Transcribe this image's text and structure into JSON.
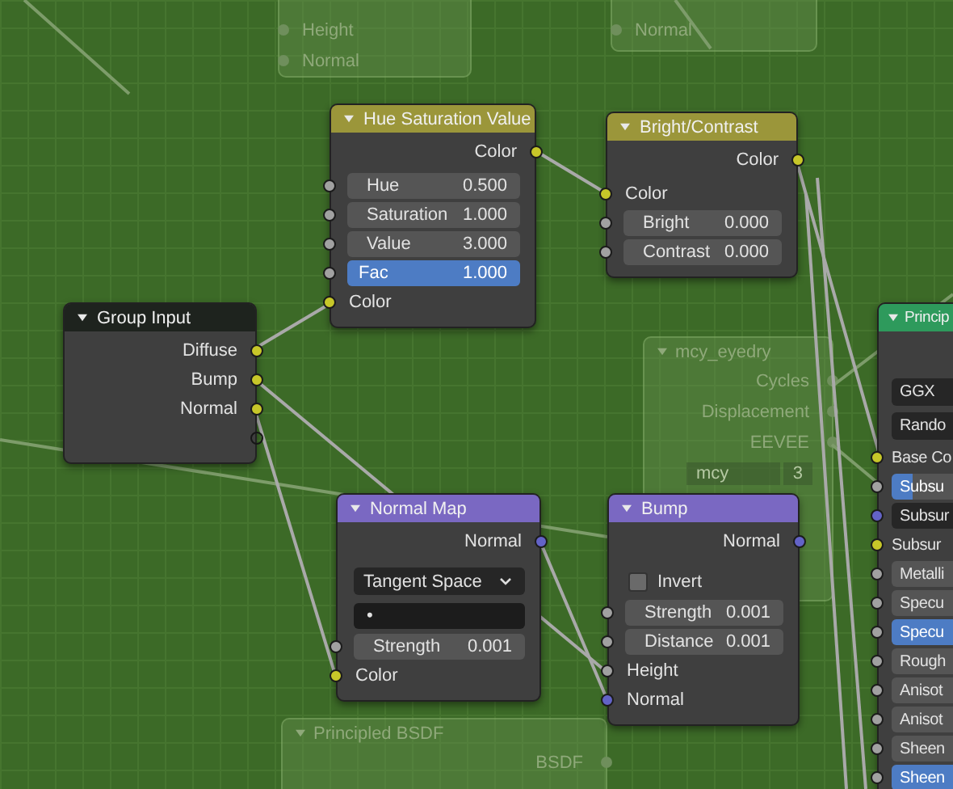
{
  "faded_nodes": [
    {
      "labels": [
        "Height",
        "Normal"
      ]
    },
    {
      "labels": [
        "Normal"
      ]
    },
    {
      "title": "mcy_eyedry",
      "outputs": [
        "Cycles",
        "Displacement",
        "EEVEE"
      ],
      "field": "mcy",
      "count": "3"
    },
    {
      "title": "Principled BSDF",
      "outputs": [
        "BSDF"
      ]
    }
  ],
  "nodes": [
    {
      "title": "Hue Saturation Value",
      "color": "#9b963a",
      "rows": [
        {
          "kind": "output",
          "label": "Color",
          "color": "#c7c729"
        },
        {
          "kind": "value",
          "label": "Hue",
          "value": "0.500",
          "color": "#a1a1a1"
        },
        {
          "kind": "value",
          "label": "Saturation",
          "value": "1.000",
          "color": "#a1a1a1"
        },
        {
          "kind": "value",
          "label": "Value",
          "value": "3.000",
          "color": "#a1a1a1"
        },
        {
          "kind": "slider",
          "label": "Fac",
          "value": "1.000",
          "level": 1,
          "color": "#a1a1a1"
        },
        {
          "kind": "input",
          "label": "Color",
          "color": "#c7c729"
        }
      ]
    },
    {
      "title": "Bright/Contrast",
      "color": "#9b963a",
      "rows": [
        {
          "kind": "output",
          "label": "Color",
          "color": "#c7c729"
        },
        {
          "kind": "input",
          "label": "Color",
          "color": "#c7c729"
        },
        {
          "kind": "value",
          "label": "Bright",
          "value": "0.000",
          "color": "#a1a1a1"
        },
        {
          "kind": "value",
          "label": "Contrast",
          "value": "0.000",
          "color": "#a1a1a1"
        }
      ]
    },
    {
      "title": "Group Input",
      "color": "#1e231e",
      "rows": [
        {
          "kind": "output",
          "label": "Diffuse",
          "color": "#c7c729"
        },
        {
          "kind": "output",
          "label": "Bump",
          "color": "#c7c729"
        },
        {
          "kind": "output",
          "label": "Normal",
          "color": "#c7c729"
        },
        {
          "kind": "spare"
        }
      ]
    },
    {
      "title": "Normal Map",
      "color": "#7a68c2",
      "rows": [
        {
          "kind": "output",
          "label": "Normal",
          "color": "#6363c7"
        },
        {
          "kind": "dropdown",
          "value": "Tangent Space"
        },
        {
          "kind": "text",
          "value": "•"
        },
        {
          "kind": "value",
          "label": "Strength",
          "value": "0.001",
          "color": "#a1a1a1"
        },
        {
          "kind": "input",
          "label": "Color",
          "color": "#c7c729"
        }
      ]
    },
    {
      "title": "Bump",
      "color": "#7a68c2",
      "rows": [
        {
          "kind": "output",
          "label": "Normal",
          "color": "#6363c7"
        },
        {
          "kind": "checkbox",
          "label": "Invert",
          "checked": false
        },
        {
          "kind": "value",
          "label": "Strength",
          "value": "0.001",
          "color": "#a1a1a1"
        },
        {
          "kind": "value",
          "label": "Distance",
          "value": "0.001",
          "color": "#a1a1a1"
        },
        {
          "kind": "input",
          "label": "Height",
          "color": "#a1a1a1"
        },
        {
          "kind": "input",
          "label": "Normal",
          "color": "#6363c7"
        }
      ]
    },
    {
      "title": "Princip",
      "color": "#2e9a5c",
      "rows": [
        {
          "kind": "dropdown",
          "value": "GGX"
        },
        {
          "kind": "dropdown",
          "value": "Rando"
        },
        {
          "kind": "input",
          "label": "Base Co",
          "color": "#c7c729"
        },
        {
          "kind": "slider",
          "label": "Subsu",
          "level": 0.1,
          "color": "#a1a1a1"
        },
        {
          "kind": "vector",
          "label": "Subsur",
          "color": "#6363c7"
        },
        {
          "kind": "input",
          "label": "Subsur",
          "color": "#c7c729"
        },
        {
          "kind": "value",
          "label": "Metalli",
          "color": "#a1a1a1"
        },
        {
          "kind": "value",
          "label": "Specu",
          "color": "#a1a1a1"
        },
        {
          "kind": "slider",
          "label": "Specu",
          "level": 0.5,
          "color": "#a1a1a1"
        },
        {
          "kind": "value",
          "label": "Rough",
          "color": "#a1a1a1"
        },
        {
          "kind": "value",
          "label": "Anisot",
          "color": "#a1a1a1"
        },
        {
          "kind": "value",
          "label": "Anisot",
          "color": "#a1a1a1"
        },
        {
          "kind": "value",
          "label": "Sheen",
          "color": "#a1a1a1"
        },
        {
          "kind": "slider",
          "label": "Sheen",
          "level": 0.5,
          "color": "#a1a1a1"
        }
      ]
    }
  ]
}
